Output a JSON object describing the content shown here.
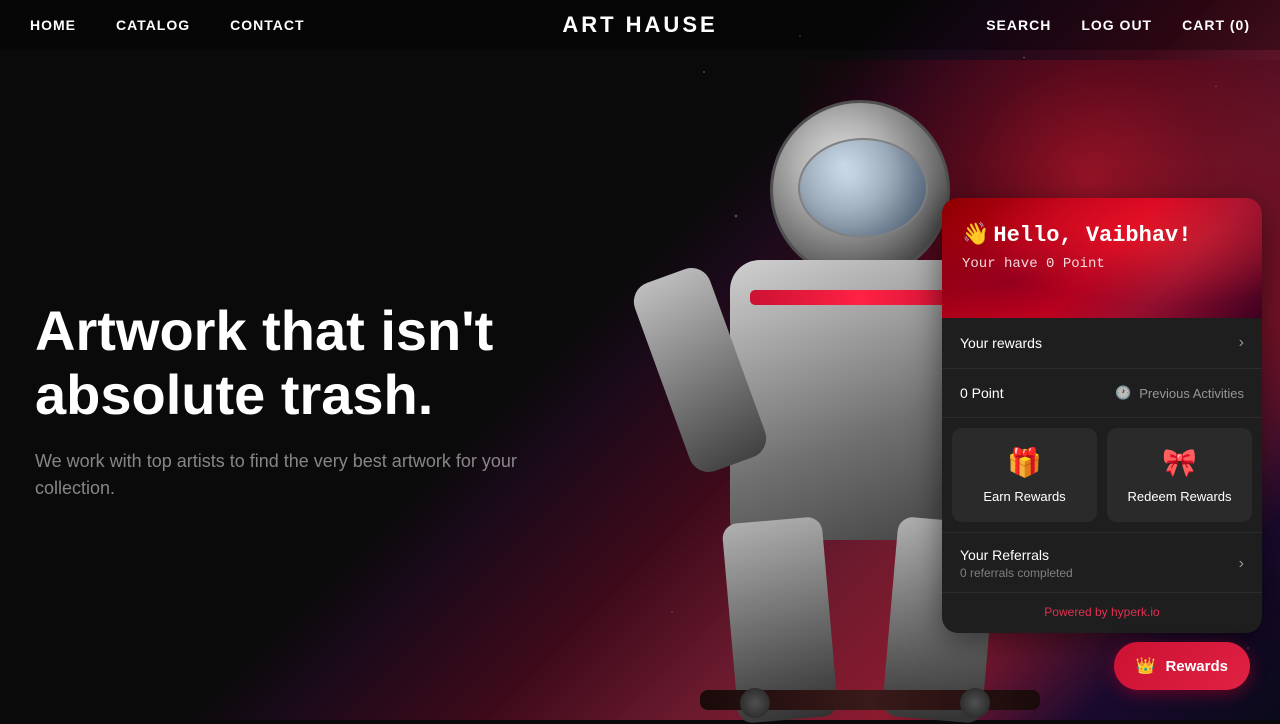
{
  "nav": {
    "brand": "ART HAUSE",
    "links": [
      {
        "id": "home",
        "label": "HOME"
      },
      {
        "id": "catalog",
        "label": "CATALOG"
      },
      {
        "id": "contact",
        "label": "CONTACT"
      }
    ],
    "right": [
      {
        "id": "search",
        "label": "SEARCH"
      },
      {
        "id": "logout",
        "label": "LOG OUT"
      },
      {
        "id": "cart",
        "label": "CART (0)"
      }
    ]
  },
  "hero": {
    "headline": "Artwork that isn't absolute trash.",
    "subtext": "We work with top artists to find the very best artwork for your collection."
  },
  "rewards_panel": {
    "greeting": "Hello, Vaibhav!",
    "wave": "👋",
    "points_text": "Your have 0 Point",
    "your_rewards_label": "Your rewards",
    "points_row": {
      "left": "0 Point",
      "right": "Previous Activities"
    },
    "earn_label": "Earn Rewards",
    "earn_icon": "🎁",
    "redeem_label": "Redeem Rewards",
    "redeem_icon": "🎀",
    "referrals_label": "Your Referrals",
    "referrals_sub": "0 referrals completed",
    "powered_label": "Powered by ",
    "powered_link": "hyperk.io"
  },
  "rewards_button": {
    "icon": "👑",
    "label": "Rewards"
  }
}
